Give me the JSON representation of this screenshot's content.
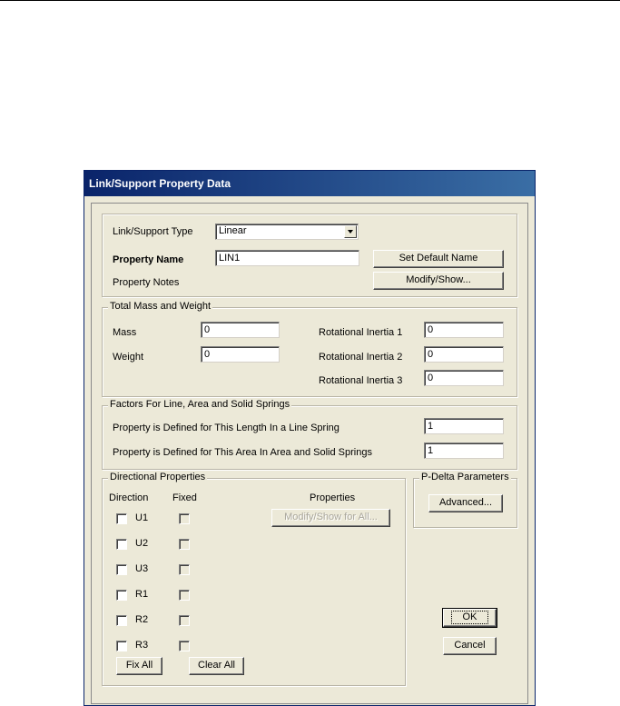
{
  "dialog": {
    "title": "Link/Support Property Data"
  },
  "top": {
    "type_label": "Link/Support Type",
    "type_value": "Linear",
    "name_label": "Property Name",
    "name_value": "LIN1",
    "set_default_name": "Set Default Name",
    "notes_label": "Property Notes",
    "modify_show": "Modify/Show..."
  },
  "mass": {
    "title": "Total Mass and Weight",
    "mass_label": "Mass",
    "mass_value": "0",
    "weight_label": "Weight",
    "weight_value": "0",
    "ri1_label": "Rotational Inertia 1",
    "ri1_value": "0",
    "ri2_label": "Rotational Inertia 2",
    "ri2_value": "0",
    "ri3_label": "Rotational Inertia 3",
    "ri3_value": "0"
  },
  "factors": {
    "title": "Factors For Line, Area and Solid Springs",
    "line_label": "Property is Defined for This Length In a Line Spring",
    "line_value": "1",
    "area_label": "Property is Defined for This Area In Area and Solid Springs",
    "area_value": "1"
  },
  "directional": {
    "title": "Directional Properties",
    "col_direction": "Direction",
    "col_fixed": "Fixed",
    "col_properties": "Properties",
    "modify_all": "Modify/Show for All...",
    "dofs": [
      "U1",
      "U2",
      "U3",
      "R1",
      "R2",
      "R3"
    ],
    "fix_all": "Fix All",
    "clear_all": "Clear All"
  },
  "pdelta": {
    "title": "P-Delta Parameters",
    "advanced": "Advanced..."
  },
  "buttons": {
    "ok": "OK",
    "cancel": "Cancel"
  }
}
